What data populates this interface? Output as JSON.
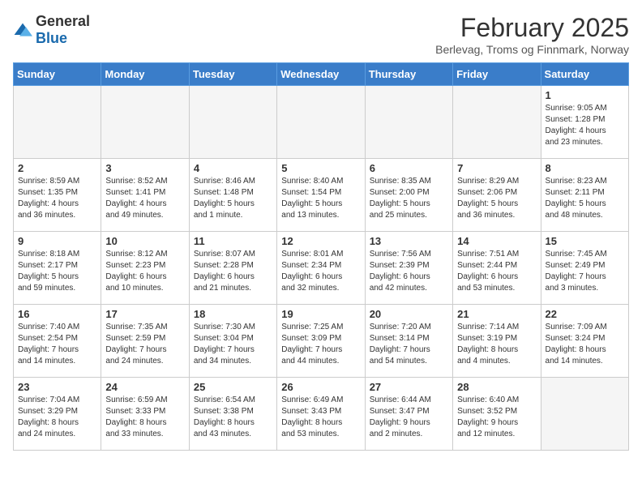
{
  "header": {
    "logo_general": "General",
    "logo_blue": "Blue",
    "title": "February 2025",
    "subtitle": "Berlevag, Troms og Finnmark, Norway"
  },
  "weekdays": [
    "Sunday",
    "Monday",
    "Tuesday",
    "Wednesday",
    "Thursday",
    "Friday",
    "Saturday"
  ],
  "weeks": [
    [
      {
        "day": "",
        "info": ""
      },
      {
        "day": "",
        "info": ""
      },
      {
        "day": "",
        "info": ""
      },
      {
        "day": "",
        "info": ""
      },
      {
        "day": "",
        "info": ""
      },
      {
        "day": "",
        "info": ""
      },
      {
        "day": "1",
        "info": "Sunrise: 9:05 AM\nSunset: 1:28 PM\nDaylight: 4 hours\nand 23 minutes."
      }
    ],
    [
      {
        "day": "2",
        "info": "Sunrise: 8:59 AM\nSunset: 1:35 PM\nDaylight: 4 hours\nand 36 minutes."
      },
      {
        "day": "3",
        "info": "Sunrise: 8:52 AM\nSunset: 1:41 PM\nDaylight: 4 hours\nand 49 minutes."
      },
      {
        "day": "4",
        "info": "Sunrise: 8:46 AM\nSunset: 1:48 PM\nDaylight: 5 hours\nand 1 minute."
      },
      {
        "day": "5",
        "info": "Sunrise: 8:40 AM\nSunset: 1:54 PM\nDaylight: 5 hours\nand 13 minutes."
      },
      {
        "day": "6",
        "info": "Sunrise: 8:35 AM\nSunset: 2:00 PM\nDaylight: 5 hours\nand 25 minutes."
      },
      {
        "day": "7",
        "info": "Sunrise: 8:29 AM\nSunset: 2:06 PM\nDaylight: 5 hours\nand 36 minutes."
      },
      {
        "day": "8",
        "info": "Sunrise: 8:23 AM\nSunset: 2:11 PM\nDaylight: 5 hours\nand 48 minutes."
      }
    ],
    [
      {
        "day": "9",
        "info": "Sunrise: 8:18 AM\nSunset: 2:17 PM\nDaylight: 5 hours\nand 59 minutes."
      },
      {
        "day": "10",
        "info": "Sunrise: 8:12 AM\nSunset: 2:23 PM\nDaylight: 6 hours\nand 10 minutes."
      },
      {
        "day": "11",
        "info": "Sunrise: 8:07 AM\nSunset: 2:28 PM\nDaylight: 6 hours\nand 21 minutes."
      },
      {
        "day": "12",
        "info": "Sunrise: 8:01 AM\nSunset: 2:34 PM\nDaylight: 6 hours\nand 32 minutes."
      },
      {
        "day": "13",
        "info": "Sunrise: 7:56 AM\nSunset: 2:39 PM\nDaylight: 6 hours\nand 42 minutes."
      },
      {
        "day": "14",
        "info": "Sunrise: 7:51 AM\nSunset: 2:44 PM\nDaylight: 6 hours\nand 53 minutes."
      },
      {
        "day": "15",
        "info": "Sunrise: 7:45 AM\nSunset: 2:49 PM\nDaylight: 7 hours\nand 3 minutes."
      }
    ],
    [
      {
        "day": "16",
        "info": "Sunrise: 7:40 AM\nSunset: 2:54 PM\nDaylight: 7 hours\nand 14 minutes."
      },
      {
        "day": "17",
        "info": "Sunrise: 7:35 AM\nSunset: 2:59 PM\nDaylight: 7 hours\nand 24 minutes."
      },
      {
        "day": "18",
        "info": "Sunrise: 7:30 AM\nSunset: 3:04 PM\nDaylight: 7 hours\nand 34 minutes."
      },
      {
        "day": "19",
        "info": "Sunrise: 7:25 AM\nSunset: 3:09 PM\nDaylight: 7 hours\nand 44 minutes."
      },
      {
        "day": "20",
        "info": "Sunrise: 7:20 AM\nSunset: 3:14 PM\nDaylight: 7 hours\nand 54 minutes."
      },
      {
        "day": "21",
        "info": "Sunrise: 7:14 AM\nSunset: 3:19 PM\nDaylight: 8 hours\nand 4 minutes."
      },
      {
        "day": "22",
        "info": "Sunrise: 7:09 AM\nSunset: 3:24 PM\nDaylight: 8 hours\nand 14 minutes."
      }
    ],
    [
      {
        "day": "23",
        "info": "Sunrise: 7:04 AM\nSunset: 3:29 PM\nDaylight: 8 hours\nand 24 minutes."
      },
      {
        "day": "24",
        "info": "Sunrise: 6:59 AM\nSunset: 3:33 PM\nDaylight: 8 hours\nand 33 minutes."
      },
      {
        "day": "25",
        "info": "Sunrise: 6:54 AM\nSunset: 3:38 PM\nDaylight: 8 hours\nand 43 minutes."
      },
      {
        "day": "26",
        "info": "Sunrise: 6:49 AM\nSunset: 3:43 PM\nDaylight: 8 hours\nand 53 minutes."
      },
      {
        "day": "27",
        "info": "Sunrise: 6:44 AM\nSunset: 3:47 PM\nDaylight: 9 hours\nand 2 minutes."
      },
      {
        "day": "28",
        "info": "Sunrise: 6:40 AM\nSunset: 3:52 PM\nDaylight: 9 hours\nand 12 minutes."
      },
      {
        "day": "",
        "info": ""
      }
    ]
  ]
}
